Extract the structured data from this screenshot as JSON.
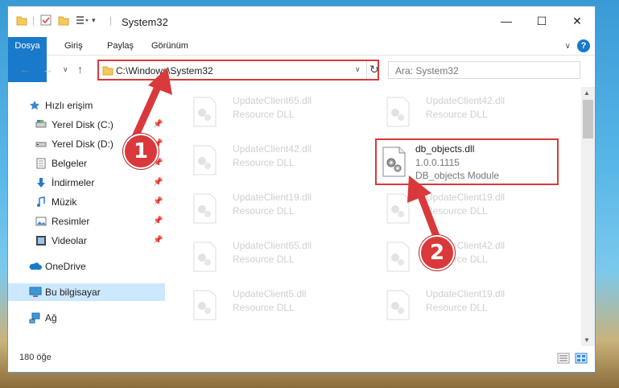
{
  "window": {
    "title": "System32",
    "buttons": {
      "minimize": "—",
      "maximize": "☐",
      "close": "✕"
    }
  },
  "ribbon": {
    "tabs": [
      "Dosya",
      "Giriş",
      "Paylaş",
      "Görünüm"
    ],
    "help": "?"
  },
  "address": {
    "path": "C:\\Windows\\System32",
    "search_placeholder": "Ara: System32"
  },
  "sidebar": {
    "items": [
      {
        "label": "Hızlı erişim",
        "icon": "star-icon"
      },
      {
        "label": "Yerel Disk (C:)",
        "icon": "drive-icon",
        "pinned": true
      },
      {
        "label": "Yerel Disk (D:)",
        "icon": "drive-icon",
        "pinned": true
      },
      {
        "label": "Belgeler",
        "icon": "documents-icon",
        "pinned": true
      },
      {
        "label": "İndirmeler",
        "icon": "download-icon",
        "pinned": true
      },
      {
        "label": "Müzik",
        "icon": "music-icon",
        "pinned": true
      },
      {
        "label": "Resimler",
        "icon": "pictures-icon",
        "pinned": true
      },
      {
        "label": "Videolar",
        "icon": "videos-icon",
        "pinned": true
      },
      {
        "label": "OneDrive",
        "icon": "cloud-icon"
      },
      {
        "label": "Bu bilgisayar",
        "icon": "computer-icon",
        "selected": true
      },
      {
        "label": "Ağ",
        "icon": "network-icon"
      }
    ]
  },
  "files": [
    {
      "name": "UpdateClient65.dll",
      "desc": "Resource DLL"
    },
    {
      "name": "UpdateClient42.dll",
      "desc": "Resource DLL"
    },
    {
      "name": "UpdateClient42.dll",
      "desc": "Resource DLL"
    },
    {
      "name": "db_objects.dll",
      "desc": "1.0.0.1115",
      "desc2": "DB_objects Module"
    },
    {
      "name": "UpdateClient19.dll",
      "desc": "Resource DLL"
    },
    {
      "name": "UpdateClient19.dll",
      "desc": "Resource DLL"
    },
    {
      "name": "UpdateClient65.dll",
      "desc": "Resource DLL"
    },
    {
      "name": "UpdateClient42.dll",
      "desc": "Resource DLL"
    },
    {
      "name": "UpdateClient5.dll",
      "desc": "Resource DLL"
    },
    {
      "name": "UpdateClient19.dll",
      "desc": "Resource DLL"
    }
  ],
  "status": {
    "count": "180 öğe"
  },
  "annotations": {
    "step1": "1",
    "step2": "2"
  },
  "colors": {
    "accent": "#1979ca",
    "highlight": "#d9393b"
  }
}
